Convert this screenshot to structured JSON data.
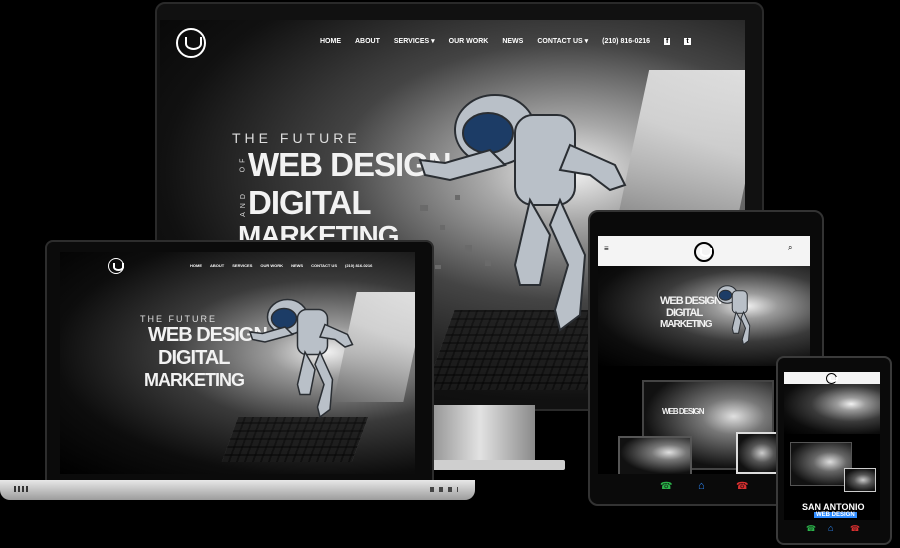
{
  "site": {
    "nav": [
      "HOME",
      "ABOUT",
      "SERVICES",
      "OUR WORK",
      "NEWS",
      "CONTACT US"
    ],
    "phone": "(210) 816-0216",
    "hero": {
      "line1": "THE FUTURE",
      "line2": "WEB DESIGN",
      "line3": "DIGITAL",
      "line4": "MARKETING",
      "of": "OF",
      "and": "AND"
    },
    "phone_banner": {
      "line1": "SAN ANTONIO",
      "line2": "WEB DESIGN"
    }
  },
  "icons": [
    "logo-icon",
    "facebook-icon",
    "twitter-icon",
    "chevron-down-icon",
    "menu-icon",
    "search-icon",
    "phone-icon",
    "home-icon",
    "hangup-icon"
  ],
  "colors": {
    "background": "#000000",
    "accent_blue": "#2f8cff",
    "phone_green": "#2bb34a",
    "phone_red": "#d93030"
  }
}
